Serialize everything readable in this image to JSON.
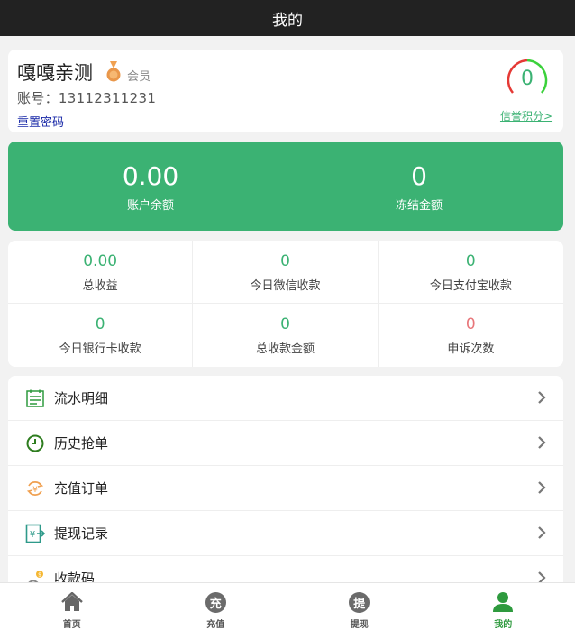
{
  "header": {
    "title": "我的"
  },
  "profile": {
    "username": "嘎嘎亲测",
    "member_label": "会员",
    "account": "账号：13112311231",
    "reset_password": "重置密码",
    "credit_score": "0",
    "credit_link": "信誉积分>"
  },
  "balance": {
    "account_balance": "0.00",
    "account_balance_label": "账户余额",
    "frozen_amount": "0",
    "frozen_amount_label": "冻结金额"
  },
  "stats": [
    {
      "value": "0.00",
      "label": "总收益"
    },
    {
      "value": "0",
      "label": "今日微信收款"
    },
    {
      "value": "0",
      "label": "今日支付宝收款"
    },
    {
      "value": "0",
      "label": "今日银行卡收款"
    },
    {
      "value": "0",
      "label": "总收款金额"
    },
    {
      "value": "0",
      "label": "申诉次数"
    }
  ],
  "menu": [
    {
      "label": "流水明细",
      "icon": "ledger-icon"
    },
    {
      "label": "历史抢单",
      "icon": "clock-icon"
    },
    {
      "label": "充值订单",
      "icon": "recharge-icon"
    },
    {
      "label": "提现记录",
      "icon": "withdraw-icon"
    },
    {
      "label": "收款码",
      "icon": "qrcode-icon"
    }
  ],
  "tabbar": [
    {
      "label": "首页",
      "icon": "home-icon"
    },
    {
      "label": "充值",
      "icon": "recharge-tab-icon",
      "glyph": "充"
    },
    {
      "label": "提现",
      "icon": "withdraw-tab-icon",
      "glyph": "提"
    },
    {
      "label": "我的",
      "icon": "user-icon",
      "active": true
    }
  ],
  "colors": {
    "accent": "#3bb273",
    "topbar": "#222222",
    "alert": "#e8767a"
  }
}
